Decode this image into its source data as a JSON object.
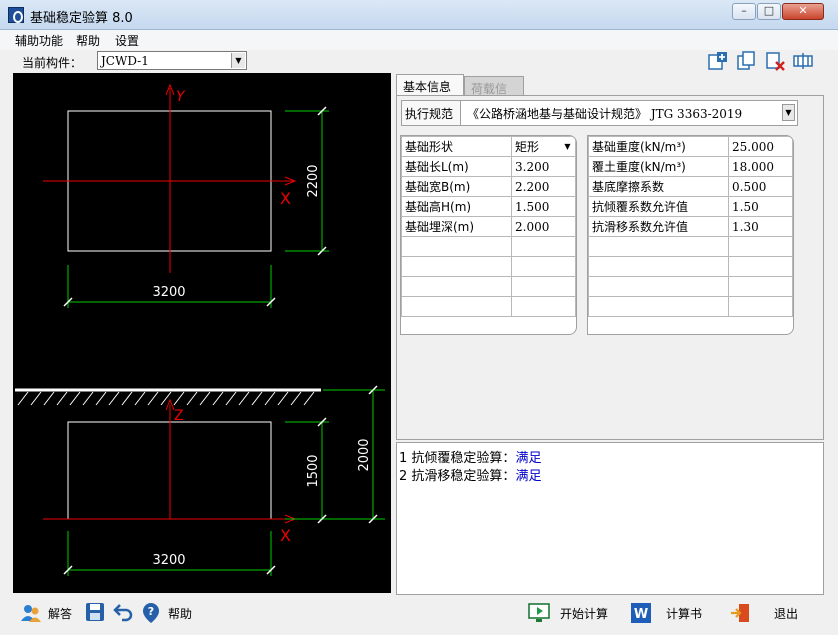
{
  "window": {
    "title": "基础稳定验算 8.0",
    "minimize": "–",
    "maximize": "□",
    "close": "✕"
  },
  "menu": [
    "辅助功能",
    "帮助",
    "设置"
  ],
  "member": {
    "label": "当前构件：",
    "value": "JCWD-1"
  },
  "toolbar_icons": [
    "add-icon",
    "copy-icon",
    "delete-icon",
    "settings-icon"
  ],
  "drawing": {
    "plan": {
      "width_label": "3200",
      "height_label": "2200",
      "axis_y": "Y",
      "axis_x": "X"
    },
    "elevation": {
      "width_label": "3200",
      "height_label": "1500",
      "depth_label": "2000",
      "axis_z": "Z",
      "axis_x": "X"
    }
  },
  "tabs": {
    "active": "基本信息",
    "inactive": "荷载信息"
  },
  "standard": {
    "label": "执行规范",
    "name": "《公路桥涵地基与基础设计规范》",
    "code": "JTG 3363-2019"
  },
  "left_table": [
    {
      "label": "基础形状",
      "value": "矩形"
    },
    {
      "label": "基础长L(m)",
      "value": "3.200"
    },
    {
      "label": "基础宽B(m)",
      "value": "2.200"
    },
    {
      "label": "基础高H(m)",
      "value": "1.500"
    },
    {
      "label": "基础埋深(m)",
      "value": "2.000"
    }
  ],
  "right_table": [
    {
      "label": "基础重度(kN/m³)",
      "value": "25.000"
    },
    {
      "label": "覆土重度(kN/m³)",
      "value": "18.000"
    },
    {
      "label": "基底摩擦系数",
      "value": "0.500"
    },
    {
      "label": "抗倾覆系数允许值",
      "value": "1.50"
    },
    {
      "label": "抗滑移系数允许值",
      "value": "1.30"
    }
  ],
  "results": [
    {
      "num": "1",
      "text": "抗倾覆稳定验算：",
      "status": "满足"
    },
    {
      "num": "2",
      "text": "抗滑移稳定验算：",
      "status": "满足"
    }
  ],
  "bottom": {
    "answer": "解答",
    "help": "帮助",
    "start": "开始计算",
    "report": "计算书",
    "exit": "退出"
  }
}
